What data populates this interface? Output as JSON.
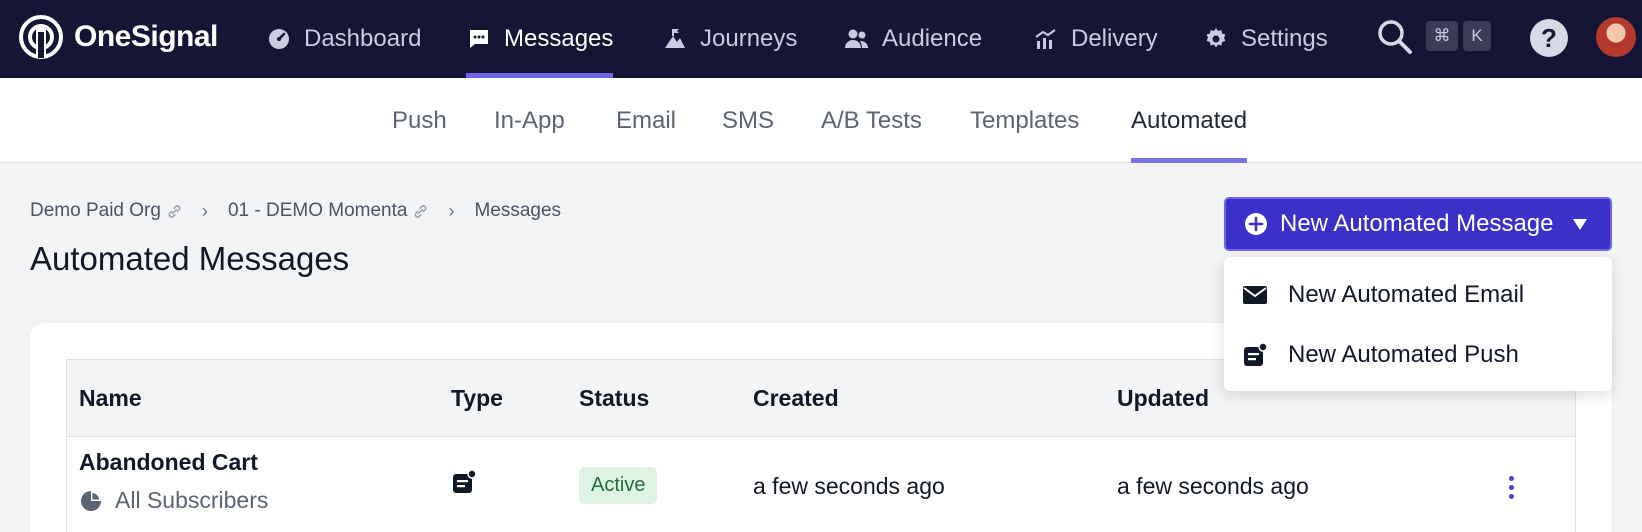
{
  "brand": {
    "name": "OneSignal"
  },
  "topnav": {
    "items": [
      {
        "label": "Dashboard",
        "icon": "dashboard-icon"
      },
      {
        "label": "Messages",
        "icon": "message-icon",
        "active": true
      },
      {
        "label": "Journeys",
        "icon": "journey-icon"
      },
      {
        "label": "Audience",
        "icon": "people-icon"
      },
      {
        "label": "Delivery",
        "icon": "chart-icon"
      },
      {
        "label": "Settings",
        "icon": "gear-icon"
      }
    ],
    "shortcut_keys": [
      "⌘",
      "K"
    ],
    "help_label": "?"
  },
  "subnav": {
    "tabs": [
      {
        "label": "Push"
      },
      {
        "label": "In-App"
      },
      {
        "label": "Email"
      },
      {
        "label": "SMS"
      },
      {
        "label": "A/B Tests"
      },
      {
        "label": "Templates"
      },
      {
        "label": "Automated",
        "active": true
      }
    ]
  },
  "breadcrumb": {
    "org": "Demo Paid Org",
    "app": "01 - DEMO Momenta",
    "current": "Messages",
    "separator": "›"
  },
  "page": {
    "title": "Automated Messages"
  },
  "new_button": {
    "label": "New Automated Message",
    "menu": [
      {
        "label": "New Automated Email",
        "icon": "envelope-icon"
      },
      {
        "label": "New Automated Push",
        "icon": "push-notification-icon"
      }
    ]
  },
  "table": {
    "headers": {
      "name": "Name",
      "type": "Type",
      "status": "Status",
      "created": "Created",
      "updated": "Updated"
    },
    "rows": [
      {
        "name": "Abandoned Cart",
        "segment": "All Subscribers",
        "type_icon": "push-notification-icon",
        "status": "Active",
        "created": "a few seconds ago",
        "updated": "a few seconds ago"
      }
    ]
  },
  "colors": {
    "nav_bg": "#151535",
    "accent": "#6f64ef",
    "primary_button": "#3b31c8",
    "active_badge_bg": "#dff3e4",
    "active_badge_text": "#1f6f3a"
  }
}
